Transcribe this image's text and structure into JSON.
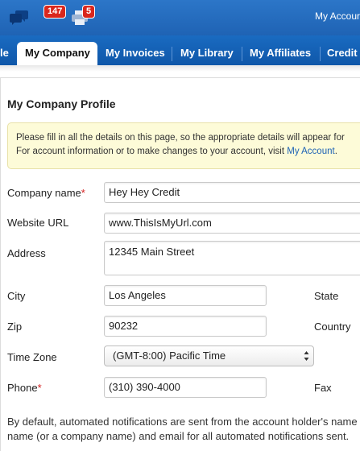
{
  "header": {
    "messages_icon": "chat-bubbles-icon",
    "messages_count": "147",
    "print_icon": "printer-icon",
    "print_count": "5",
    "account_link": "My Accour"
  },
  "nav": {
    "tabs": [
      {
        "label": "le"
      },
      {
        "label": "My Company",
        "active": true
      },
      {
        "label": "My Invoices"
      },
      {
        "label": "My Library"
      },
      {
        "label": "My Affiliates"
      },
      {
        "label": "Credit"
      }
    ]
  },
  "page": {
    "title": "My Company Profile",
    "notice_line1": "Please fill in all the details on this page, so the appropriate details will appear for",
    "notice_line2": "For account information or to make changes to your account, visit",
    "notice_link": "My Account",
    "notice_end": "."
  },
  "form": {
    "company_name": {
      "label": "Company name",
      "required_mark": "*",
      "value": "Hey Hey Credit"
    },
    "website_url": {
      "label": "Website URL",
      "value": "www.ThisIsMyUrl.com"
    },
    "address": {
      "label": "Address",
      "value": "12345 Main Street"
    },
    "city": {
      "label": "City",
      "value": "Los Angeles"
    },
    "state": {
      "label": "State"
    },
    "zip": {
      "label": "Zip",
      "value": "90232"
    },
    "country": {
      "label": "Country"
    },
    "time_zone": {
      "label": "Time Zone",
      "value": "(GMT-8:00) Pacific Time"
    },
    "phone": {
      "label": "Phone",
      "required_mark": "*",
      "value": "(310) 390-4000"
    },
    "fax": {
      "label": "Fax"
    }
  },
  "footer": {
    "line1": "By default, automated notifications are sent from the account holder's name",
    "line2": "name (or a company name) and email for all automated notifications sent."
  },
  "colors": {
    "top_bar": "#1f63b4",
    "badge": "#d9271d",
    "link": "#1d62b5",
    "required": "#d42020",
    "notice_bg": "#fdfbd8"
  }
}
